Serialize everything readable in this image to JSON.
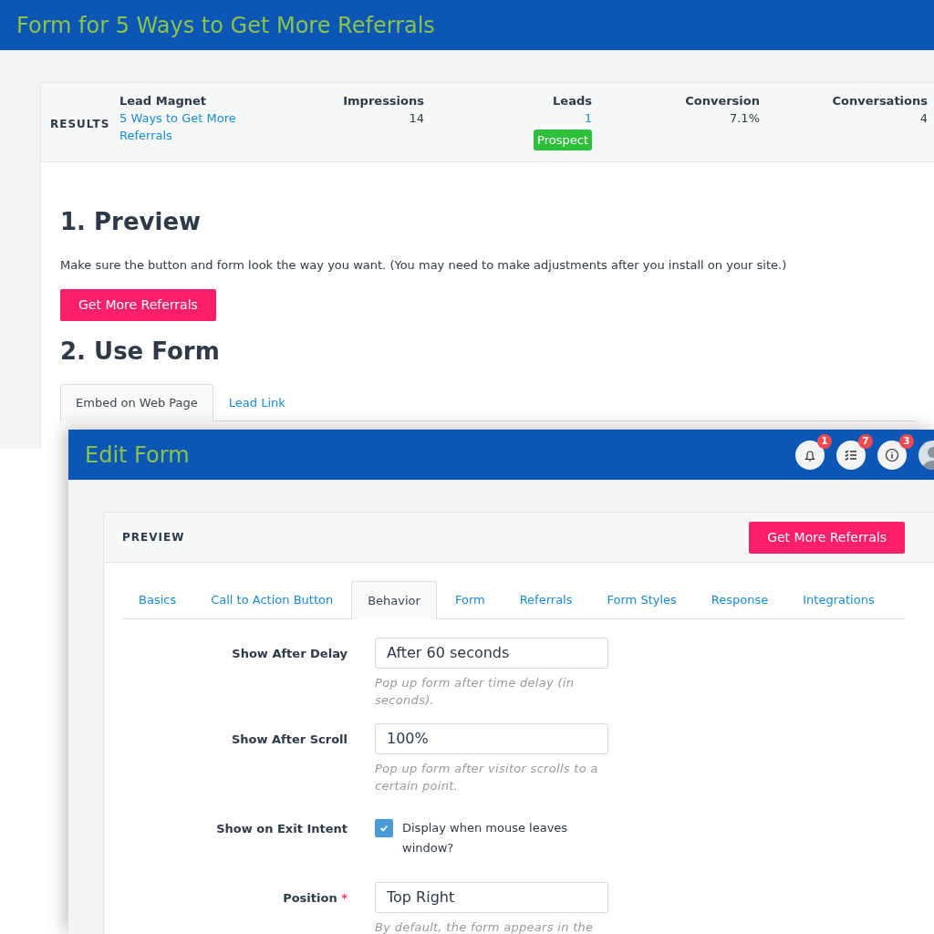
{
  "back_window": {
    "title": "Form for 5 Ways to Get More Referrals",
    "results": {
      "label": "RESULTS",
      "columns": [
        {
          "heading": "Lead Magnet",
          "value": "5 Ways to Get More Referrals",
          "kind": "link"
        },
        {
          "heading": "Impressions",
          "value": "14",
          "kind": "text"
        },
        {
          "heading": "Leads",
          "value": "1",
          "kind": "link",
          "badge": "Prospect"
        },
        {
          "heading": "Conversion",
          "value": "7.1%",
          "kind": "text"
        },
        {
          "heading": "Conversations",
          "value": "4",
          "kind": "text"
        }
      ]
    },
    "preview": {
      "heading": "1. Preview",
      "text": "Make sure the button and form look the way you want. (You may need to make adjustments after you install on your site.)",
      "button": "Get More Referrals"
    },
    "use_form": {
      "heading": "2. Use Form",
      "tabs": [
        {
          "label": "Embed on Web Page",
          "selected": true
        },
        {
          "label": "Lead Link",
          "selected": false
        }
      ]
    }
  },
  "front_window": {
    "title": "Edit Form",
    "header_icons": [
      {
        "kind": "bell",
        "badge": "1"
      },
      {
        "kind": "checklist",
        "badge": "7"
      },
      {
        "kind": "info",
        "badge": "3"
      }
    ],
    "card": {
      "title": "PREVIEW",
      "button": "Get More Referrals",
      "tabs": [
        {
          "label": "Basics",
          "selected": false
        },
        {
          "label": "Call to Action Button",
          "selected": false
        },
        {
          "label": "Behavior",
          "selected": true
        },
        {
          "label": "Form",
          "selected": false
        },
        {
          "label": "Referrals",
          "selected": false
        },
        {
          "label": "Form Styles",
          "selected": false
        },
        {
          "label": "Response",
          "selected": false
        },
        {
          "label": "Integrations",
          "selected": false
        }
      ],
      "fields": [
        {
          "kind": "text",
          "label": "Show After Delay",
          "value": "After 60 seconds",
          "help": "Pop up form after time delay (in seconds)."
        },
        {
          "kind": "text",
          "label": "Show After Scroll",
          "value": "100%",
          "help": "Pop up form after visitor scrolls to a certain point."
        },
        {
          "kind": "checkbox",
          "label": "Show on Exit Intent",
          "checked": true,
          "option": "Display when mouse leaves window?"
        },
        {
          "kind": "text",
          "label": "Position",
          "required_marker": "*",
          "value": "Top Right",
          "help": "By default, the form appears in the"
        }
      ]
    }
  }
}
